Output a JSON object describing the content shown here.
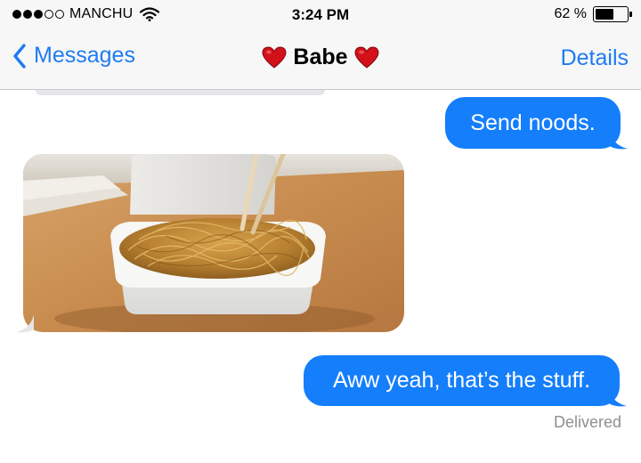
{
  "status_bar": {
    "carrier": "MANCHU",
    "time": "3:24 PM",
    "battery_text": "62 %",
    "battery_level": 0.62,
    "signal_bars": 3,
    "signal_max": 5
  },
  "nav": {
    "back_label": "Messages",
    "title": "Babe",
    "details_label": "Details",
    "accent_color": "#1f7bf2"
  },
  "conversation": {
    "messages": [
      {
        "from": "me",
        "type": "text",
        "text": "Send noods."
      },
      {
        "from": "them",
        "type": "image",
        "image": "noodles-in-takeout-box-with-chopsticks"
      },
      {
        "from": "me",
        "type": "text",
        "text": "Aww yeah, that’s the stuff."
      }
    ],
    "delivery_status": "Delivered",
    "outgoing_color": "#147efb",
    "incoming_color": "#e5e5ea"
  },
  "icons": [
    "wifi-icon",
    "battery-icon",
    "chevron-left-icon",
    "heart-icon"
  ]
}
